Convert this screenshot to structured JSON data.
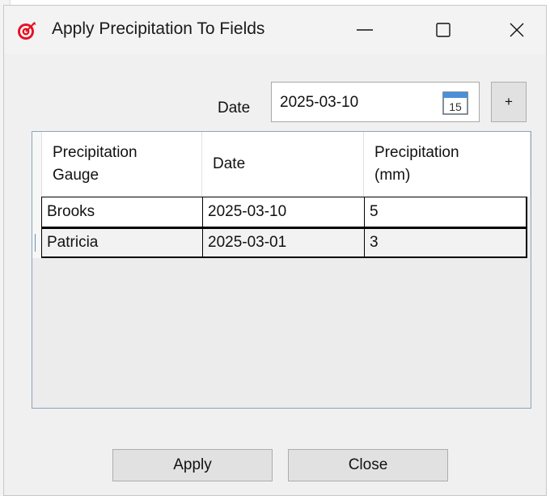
{
  "window": {
    "title": "Apply Precipitation To Fields",
    "icon": "target-icon",
    "controls": {
      "minimize": "minimize-icon",
      "maximize": "maximize-icon",
      "close": "close-icon"
    }
  },
  "date_filter": {
    "label": "Date",
    "value": "2025-03-10",
    "calendar_icon_text": "15",
    "add_label": "+"
  },
  "grid": {
    "columns": [
      {
        "line1": "Precipitation",
        "line2": "Gauge"
      },
      {
        "line1": "Date",
        "line2": ""
      },
      {
        "line1": "Precipitation",
        "line2": "(mm)"
      }
    ],
    "rows": [
      {
        "gauge": "Brooks",
        "date": "2025-03-10",
        "precipitation": "5"
      },
      {
        "gauge": "Patricia",
        "date": "2025-03-01",
        "precipitation": "3"
      }
    ]
  },
  "buttons": {
    "apply": "Apply",
    "close": "Close"
  },
  "colors": {
    "accent": "#e81123",
    "grid_border": "#8da4bd",
    "button_bg": "#e1e1e1"
  }
}
